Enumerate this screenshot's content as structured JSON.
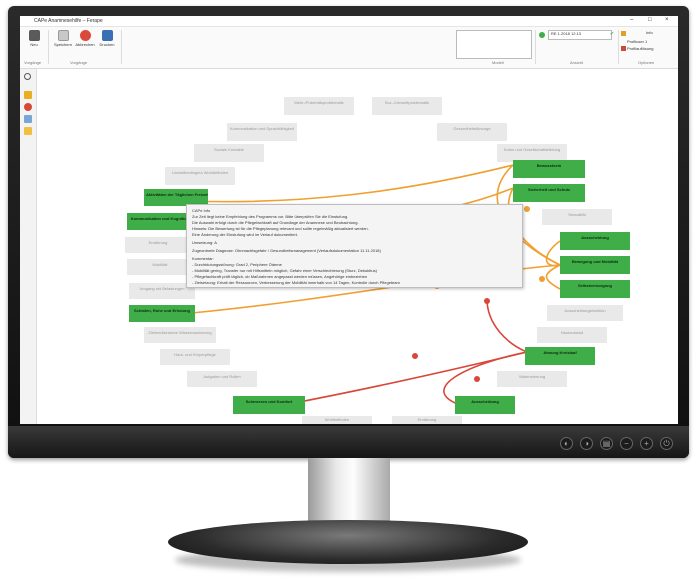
{
  "app": {
    "title": "CAPe Anamnesehilfe – Ferape",
    "window_controls": [
      "–",
      "□",
      "×"
    ]
  },
  "ribbon": {
    "buttons": [
      {
        "label": "Neu",
        "icon": "new-file-icon"
      },
      {
        "label": "Speichern",
        "icon": "save-icon"
      },
      {
        "label": "Abbrechen",
        "icon": "cancel-icon"
      },
      {
        "label": "Drucken",
        "icon": "print-icon"
      }
    ],
    "group_labels": [
      "Vorgänge",
      "Vorgänge",
      "Modell",
      "Ansicht",
      "Optionen"
    ],
    "case_selector": "RE 1.2018 12:13",
    "user": "Profiluser 1",
    "user_label": "Info",
    "profile": "Profilauflösung"
  },
  "sidebar": {
    "icons": [
      "search-icon",
      "person-icon",
      "warning-icon",
      "document-icon",
      "folder-icon"
    ]
  },
  "nodes": [
    {
      "id": "n1",
      "text": "Mehr-/Pubertätsproblematik",
      "style": "grey"
    },
    {
      "id": "n2",
      "text": "Soz.-/Umweltproblematik",
      "style": "grey"
    },
    {
      "id": "n3",
      "text": "Kommunikation und Sprachfähigkeit",
      "style": "grey"
    },
    {
      "id": "n4",
      "text": "Gesundheitsfürsorge",
      "style": "grey"
    },
    {
      "id": "n5",
      "text": "Soziale Kontakte",
      "style": "grey"
    },
    {
      "id": "n6",
      "text": "Kultur und Gesellschaftsbildung",
      "style": "grey"
    },
    {
      "id": "n7",
      "text": "Umweltbedingtes Wohlbefinden",
      "style": "grey"
    },
    {
      "id": "n8",
      "text": "Sexualität",
      "style": "grey"
    },
    {
      "id": "n9",
      "text": "Aktivitäten der Täglichen Freizeitbildung",
      "style": "green"
    },
    {
      "id": "n10",
      "text": "Kommunikation und Kognition",
      "style": "green"
    },
    {
      "id": "n11",
      "text": "Ernährung",
      "style": "grey"
    },
    {
      "id": "n12",
      "text": "Mobilität",
      "style": "grey"
    },
    {
      "id": "n13",
      "text": "Schlafen",
      "style": "grey"
    },
    {
      "id": "n14",
      "text": "Umgang mit Belastungen",
      "style": "grey"
    },
    {
      "id": "n15",
      "text": "Schlafen, Ruhe und Erholung",
      "style": "green"
    },
    {
      "id": "n16",
      "text": "Sinneswahrnehmung",
      "style": "grey"
    },
    {
      "id": "n17",
      "text": "Zielmedizinische Wissenssicherung",
      "style": "grey"
    },
    {
      "id": "n18",
      "text": "Haut- und Körperpflege",
      "style": "grey"
    },
    {
      "id": "n19",
      "text": "Aufgaben und Rollen",
      "style": "grey"
    },
    {
      "id": "n20",
      "text": "Schmerzen und Komfort",
      "style": "green"
    },
    {
      "id": "n21",
      "text": "Wohlbefinden",
      "style": "grey"
    },
    {
      "id": "n22",
      "text": "Ernährung",
      "style": "grey"
    },
    {
      "id": "n23",
      "text": "Atmung Kreislauf",
      "style": "green"
    },
    {
      "id": "n24",
      "text": "Wahrnehmung",
      "style": "grey"
    },
    {
      "id": "n25",
      "text": "Bewegung und Mobilität",
      "style": "green"
    },
    {
      "id": "n26",
      "text": "Ausscheidungsfunktion",
      "style": "grey"
    },
    {
      "id": "n27",
      "text": "Hautzustand",
      "style": "grey"
    },
    {
      "id": "n28",
      "text": "Selbstversorgung",
      "style": "green"
    },
    {
      "id": "n29",
      "text": "Bewusstsein",
      "style": "green"
    },
    {
      "id": "n30",
      "text": "Sicherheit und Schutz",
      "style": "green"
    },
    {
      "id": "n31",
      "text": "Ausscheidung",
      "style": "green"
    }
  ],
  "tooltip": {
    "lines": [
      "CAPe Info",
      "Zur Zeit liegt keine Empfehlung des Programms vor. Bitte überprüfen Sie die Einstufung.",
      "Die Auswahl erfolgt durch die Pflegefachkraft auf Grundlage der Anamnese und Beobachtung.",
      "Hinweis: Die Bewertung ist für die Pflegeplanung relevant und sollte regelmäßig aktualisiert werden.",
      "Eine Änderung der Einstufung wird im Verlauf dokumentiert.",
      "Umsetzung: A",
      "Zugeordnete Diagnose: Ohnmachtsgefahr / Gesundheitsmanagement (Verlaufsdokumentation 11.11.2018)",
      "Kommentar:",
      "- Durchblutungsstörung: Grad 2, Periphere Ödeme",
      "- Mobilität gering, Transfer nur mit Hilfsmitteln möglich, Gefahr einer Verschlechterung (Sturz, Dekubitus)",
      "- Pflegefachkraft prüft täglich, ob Maßnahmen angepasst werden müssen, Angehörige einbeziehen",
      "- Zielsetzung: Erhalt der Ressourcen, Verbesserung der Mobilität innerhalb von 14 Tagen, Kontrolle durch Pflegeteam"
    ]
  },
  "edge_labels": [
    "1",
    "2",
    "3",
    "4",
    "5",
    "6",
    "7"
  ],
  "colors": {
    "green_node": "#3fae49",
    "grey_node": "#e9e9e9",
    "orange_edge": "#f0a030",
    "red_edge": "#d9473a"
  }
}
